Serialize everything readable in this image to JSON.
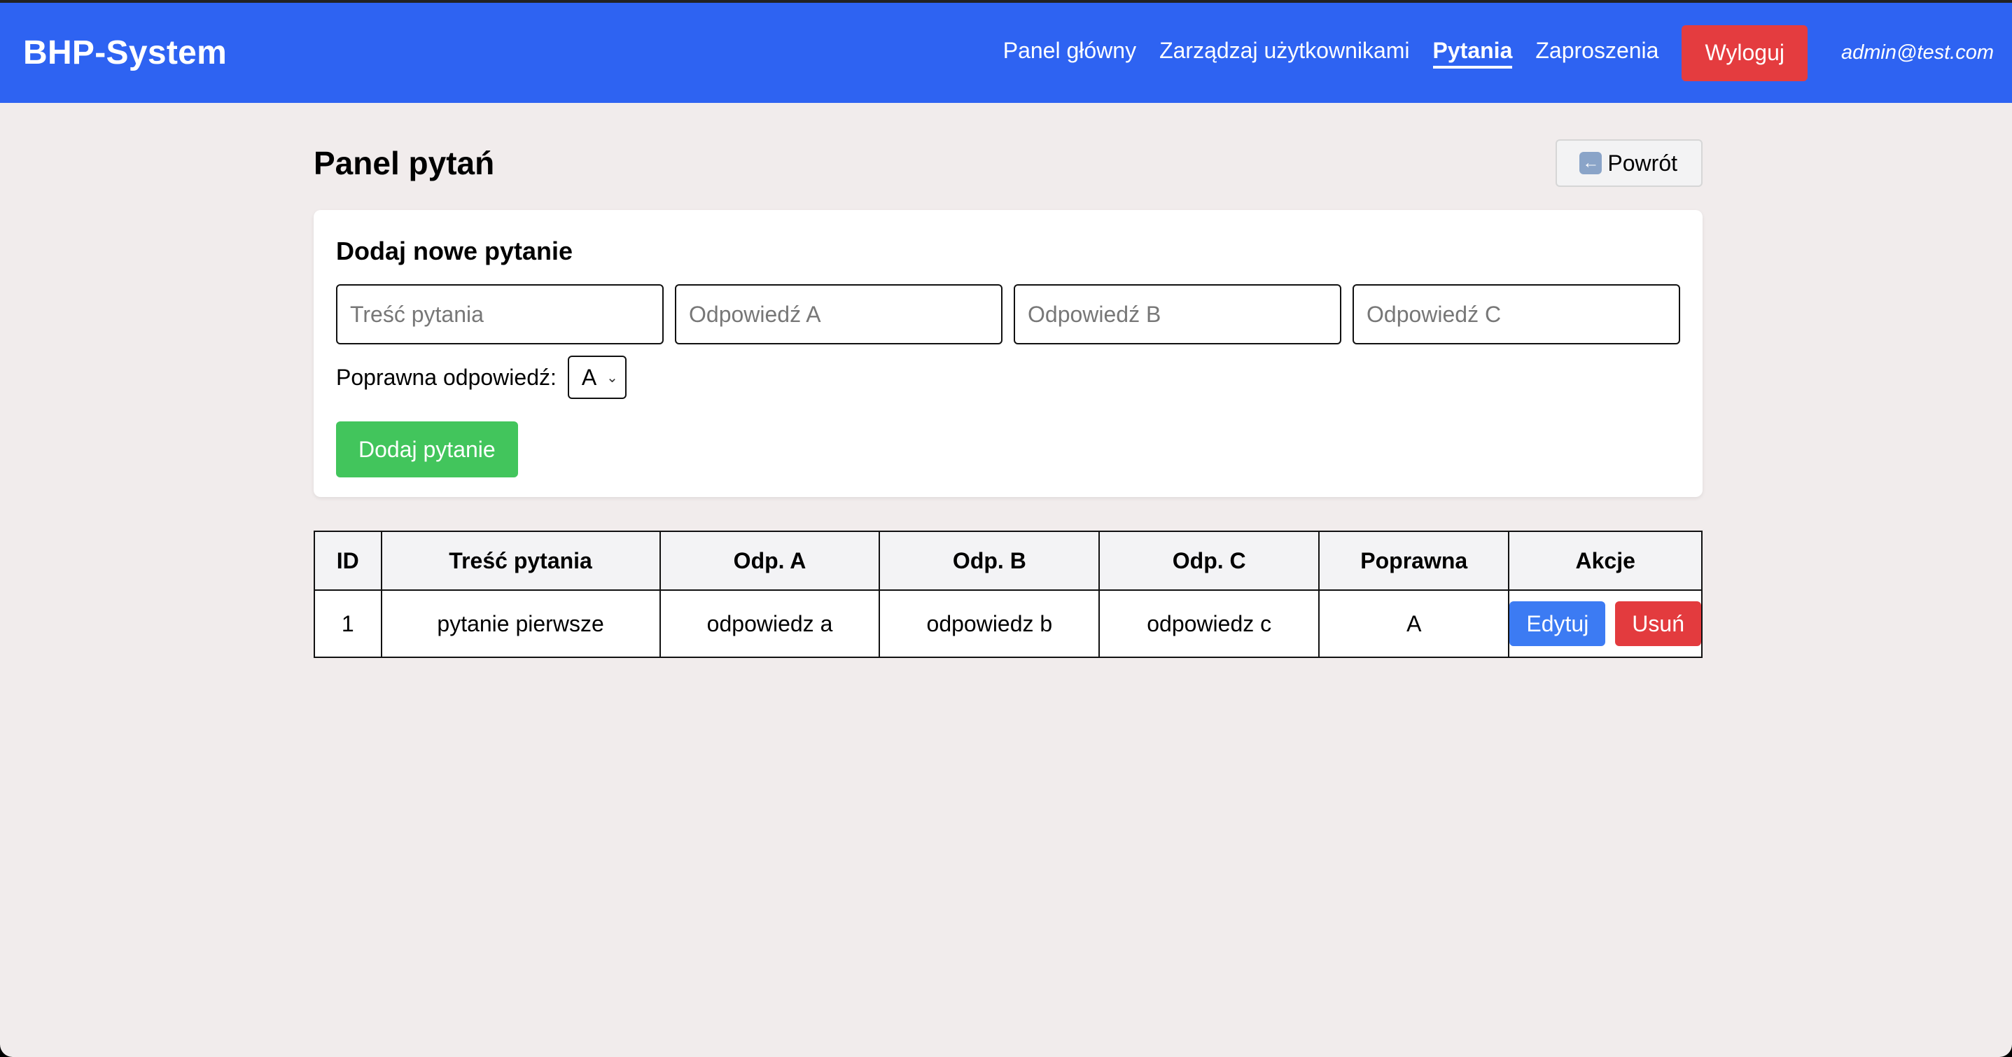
{
  "navbar": {
    "brand": "BHP-System",
    "links": [
      "Panel główny",
      "Zarządzaj użytkownikami",
      "Pytania",
      "Zaproszenia"
    ],
    "active_link": "Pytania",
    "logout_label": "Wyloguj",
    "user_email": "admin@test.com",
    "color": "#2e63f2"
  },
  "page": {
    "title": "Panel pytań",
    "back_label": "Powrót",
    "back_icon": "left-arrow-icon"
  },
  "form": {
    "title": "Dodaj nowe pytanie",
    "question_placeholder": "Treść pytania",
    "answer_a_placeholder": "Odpowiedź A",
    "answer_b_placeholder": "Odpowiedź B",
    "answer_c_placeholder": "Odpowiedź C",
    "correct_label": "Poprawna odpowiedź:",
    "correct_value": "A",
    "submit_label": "Dodaj pytanie"
  },
  "table": {
    "headers": [
      "ID",
      "Treść pytania",
      "Odp. A",
      "Odp. B",
      "Odp. C",
      "Poprawna",
      "Akcje"
    ],
    "rows": [
      {
        "id": "1",
        "question": "pytanie pierwsze",
        "a": "odpowiedz a",
        "b": "odpowiedz b",
        "c": "odpowiedz c",
        "correct": "A",
        "edit_label": "Edytuj",
        "delete_label": "Usuń"
      }
    ]
  },
  "colors": {
    "background": "#f1ecec",
    "success": "#42c55c",
    "danger": "#e33b3e",
    "primary": "#3c7bf3"
  }
}
